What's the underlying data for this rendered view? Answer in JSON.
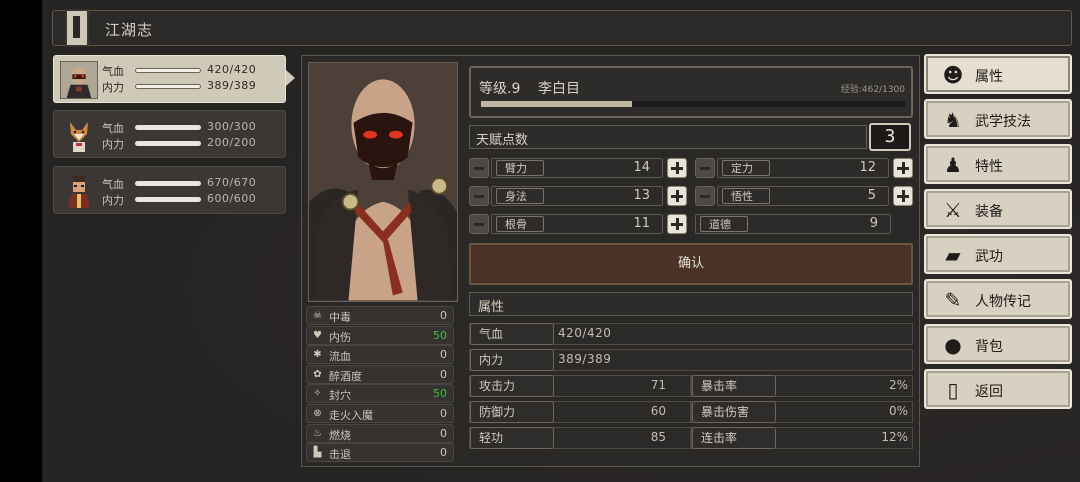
{
  "header": {
    "title": "江湖志"
  },
  "party": [
    {
      "hp_label": "气血",
      "hp": "420/420",
      "mp_label": "内力",
      "mp": "389/389",
      "active": true
    },
    {
      "hp_label": "气血",
      "hp": "300/300",
      "mp_label": "内力",
      "mp": "200/200",
      "active": false
    },
    {
      "hp_label": "气血",
      "hp": "670/670",
      "mp_label": "内力",
      "mp": "600/600",
      "active": false
    }
  ],
  "character": {
    "level_text": "等级.9",
    "name": "李白目",
    "exp_text": "经验:462/1300",
    "exp_fraction": 0.355
  },
  "talent": {
    "label": "天赋点数",
    "value": "3"
  },
  "attributes": [
    {
      "label": "臂力",
      "value": "14"
    },
    {
      "label": "定力",
      "value": "12"
    },
    {
      "label": "身法",
      "value": "13"
    },
    {
      "label": "悟性",
      "value": "5"
    },
    {
      "label": "根骨",
      "value": "11"
    },
    {
      "label": "道德",
      "value": "9"
    }
  ],
  "confirm_label": "确认",
  "properties": {
    "header": "属性",
    "hp": {
      "label": "气血",
      "value": "420/420"
    },
    "mp": {
      "label": "内力",
      "value": "389/389"
    },
    "pairs": [
      {
        "label": "攻击力",
        "value": "71"
      },
      {
        "label": "暴击率",
        "value": "2%"
      },
      {
        "label": "防御力",
        "value": "60"
      },
      {
        "label": "暴击伤害",
        "value": "0%"
      },
      {
        "label": "轻功",
        "value": "85"
      },
      {
        "label": "连击率",
        "value": "12%"
      }
    ]
  },
  "status_effects": [
    {
      "icon": "skull-icon",
      "label": "中毒",
      "value": "0",
      "highlight": false
    },
    {
      "icon": "broken-heart-icon",
      "label": "内伤",
      "value": "50",
      "highlight": true
    },
    {
      "icon": "blood-drop-icon",
      "label": "流血",
      "value": "0",
      "highlight": false
    },
    {
      "icon": "wine-icon",
      "label": "醉酒度",
      "value": "0",
      "highlight": false
    },
    {
      "icon": "acupoint-icon",
      "label": "封穴",
      "value": "50",
      "highlight": true
    },
    {
      "icon": "spiral-icon",
      "label": "走火入魔",
      "value": "0",
      "highlight": false
    },
    {
      "icon": "flame-icon",
      "label": "燃烧",
      "value": "0",
      "highlight": false
    },
    {
      "icon": "knockback-icon",
      "label": "击退",
      "value": "0",
      "highlight": false
    }
  ],
  "menu": [
    {
      "label": "属性",
      "icon": "character-icon",
      "selected": true
    },
    {
      "label": "武学技法",
      "icon": "martial-arts-icon",
      "selected": false
    },
    {
      "label": "特性",
      "icon": "trait-icon",
      "selected": false
    },
    {
      "label": "装备",
      "icon": "sword-icon",
      "selected": false
    },
    {
      "label": "武功",
      "icon": "scroll-book-icon",
      "selected": false
    },
    {
      "label": "人物传记",
      "icon": "biography-icon",
      "selected": false
    },
    {
      "label": "背包",
      "icon": "bag-icon",
      "selected": false
    },
    {
      "label": "返回",
      "icon": "door-icon",
      "selected": false
    }
  ],
  "colors": {
    "highlight_green": "#3fbf3f",
    "confirm_bg": "#4a3227",
    "menu_bg": "#d7d1c1"
  }
}
